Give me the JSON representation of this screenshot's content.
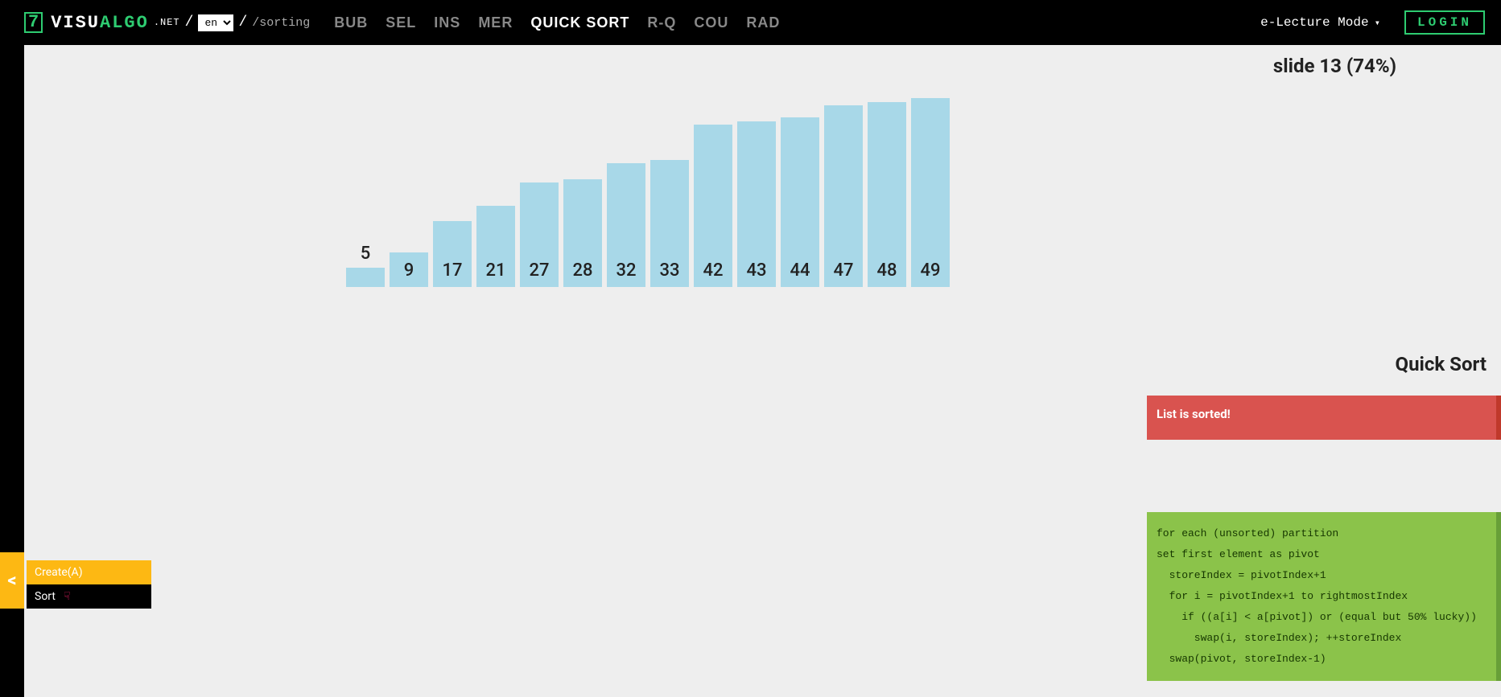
{
  "header": {
    "logo_visu": "VISU",
    "logo_algo": "ALGO",
    "logo_net": ".NET",
    "lang_selected": "en",
    "path": "/sorting",
    "algos": [
      {
        "label": "BUB",
        "active": false
      },
      {
        "label": "SEL",
        "active": false
      },
      {
        "label": "INS",
        "active": false
      },
      {
        "label": "MER",
        "active": false
      },
      {
        "label": "QUICK SORT",
        "active": true
      },
      {
        "label": "R-Q",
        "active": false
      },
      {
        "label": "COU",
        "active": false
      },
      {
        "label": "RAD",
        "active": false
      }
    ],
    "lecture_mode": "e-Lecture Mode",
    "login": "LOGIN"
  },
  "slide_indicator": "slide 13 (74%)",
  "algo_title": "Quick Sort",
  "status_message": "List is sorted!",
  "pseudocode": "for each (unsorted) partition\nset first element as pivot\n  storeIndex = pivotIndex+1\n  for i = pivotIndex+1 to rightmostIndex\n    if ((a[i] < a[pivot]) or (equal but 50% lucky))\n      swap(i, storeIndex); ++storeIndex\n  swap(pivot, storeIndex-1)",
  "actions": {
    "toggle": "<",
    "create": "Create(A)",
    "sort": "Sort"
  },
  "chart_data": {
    "type": "bar",
    "categories": [
      "5",
      "9",
      "17",
      "21",
      "27",
      "28",
      "32",
      "33",
      "42",
      "43",
      "44",
      "47",
      "48",
      "49"
    ],
    "values": [
      5,
      9,
      17,
      21,
      27,
      28,
      32,
      33,
      42,
      43,
      44,
      47,
      48,
      49
    ],
    "color": "#a8d8e8",
    "title": "",
    "xlabel": "",
    "ylabel": "",
    "ylim": [
      0,
      50
    ]
  }
}
